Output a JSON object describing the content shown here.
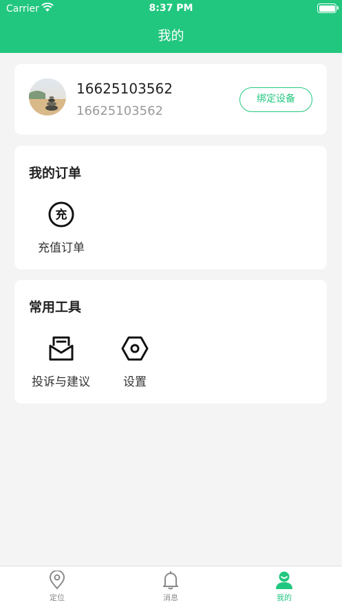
{
  "status_bar": {
    "carrier": "Carrier",
    "time": "8:37 PM"
  },
  "nav": {
    "title": "我的"
  },
  "profile": {
    "name": "16625103562",
    "phone": "16625103562",
    "bind_button": "绑定设备"
  },
  "orders": {
    "title": "我的订单",
    "items": [
      {
        "label": "充值订单",
        "icon": "recharge-icon",
        "glyph": "充"
      }
    ]
  },
  "tools": {
    "title": "常用工具",
    "items": [
      {
        "label": "投诉与建议",
        "icon": "feedback-icon"
      },
      {
        "label": "设置",
        "icon": "settings-icon"
      }
    ]
  },
  "tabbar": {
    "items": [
      {
        "label": "定位",
        "icon": "location-icon"
      },
      {
        "label": "消息",
        "icon": "bell-icon"
      },
      {
        "label": "我的",
        "icon": "user-icon",
        "active": true
      }
    ]
  },
  "colors": {
    "accent": "#22c77f",
    "background": "#f4f4f4"
  }
}
